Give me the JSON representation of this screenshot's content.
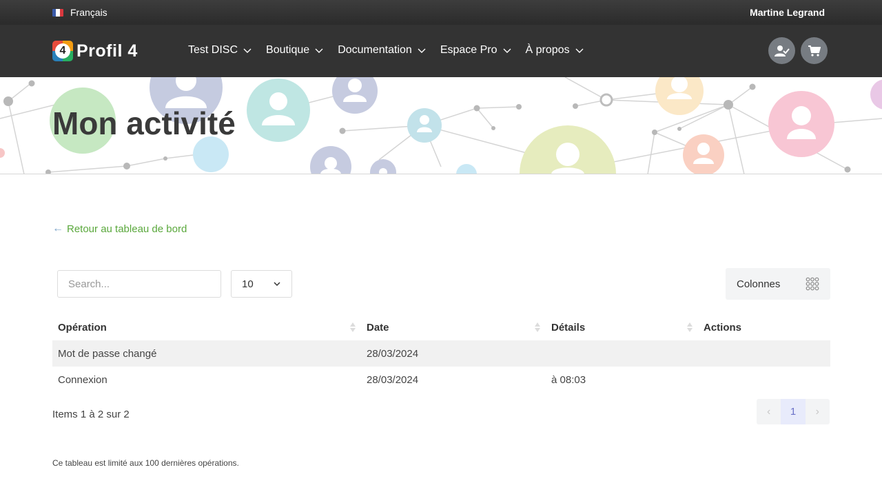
{
  "topbar": {
    "language": "Français",
    "flag_colors": [
      "#3b5aa8",
      "#ffffff",
      "#d9383e"
    ],
    "username": "Martine Legrand"
  },
  "navbar": {
    "logo_mark": "4",
    "logo_text": "Profil 4",
    "menu": [
      {
        "label": "Test DISC"
      },
      {
        "label": "Boutique"
      },
      {
        "label": "Documentation"
      },
      {
        "label": "Espace Pro"
      },
      {
        "label": "À propos"
      }
    ],
    "icons": [
      "user-check-icon",
      "cart-icon"
    ]
  },
  "banner": {
    "title": "Mon activité"
  },
  "back_link": "Retour au tableau de bord",
  "toolbar": {
    "search_placeholder": "Search...",
    "page_size": "10",
    "columns_label": "Colonnes"
  },
  "table": {
    "columns": [
      "Opération",
      "Date",
      "Détails",
      "Actions"
    ],
    "rows": [
      {
        "operation": "Mot de passe changé",
        "date": "28/03/2024",
        "details": "",
        "actions": ""
      },
      {
        "operation": "Connexion",
        "date": "28/03/2024",
        "details": "à 08:03",
        "actions": ""
      }
    ]
  },
  "pagination": {
    "info": "Items 1 à 2 sur 2",
    "current_page": "1",
    "prev": "‹",
    "next": "›"
  },
  "footnote": "Ce tableau est limité aux 100 dernières opérations.",
  "colors": {
    "link_green": "#5aa83c",
    "nav_bg": "#333333",
    "pager_active": "#6b72c8"
  }
}
